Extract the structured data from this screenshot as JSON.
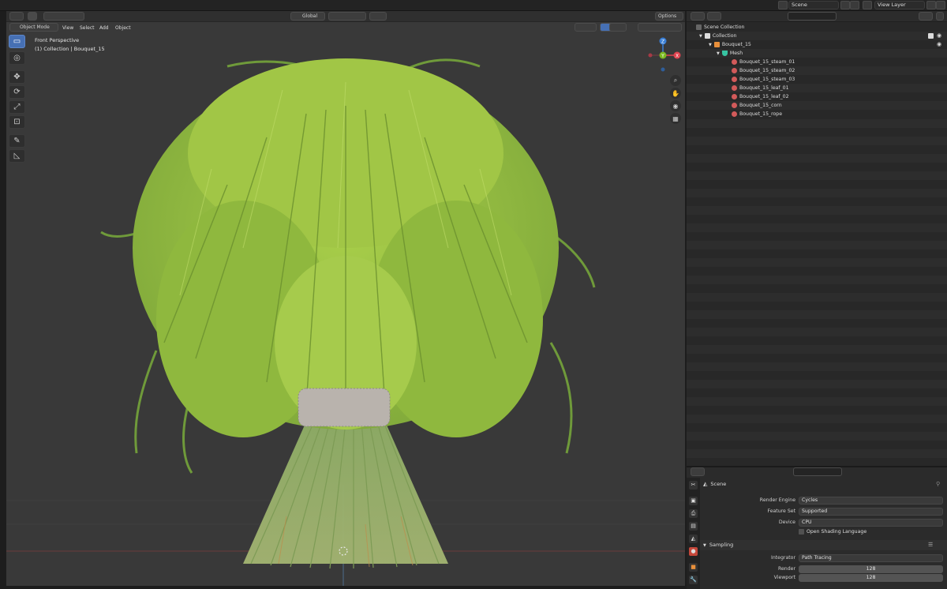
{
  "topbar": {
    "scene": "Scene",
    "view_layer": "View Layer"
  },
  "viewport": {
    "mode": "Object Mode",
    "menus": [
      "View",
      "Select",
      "Add",
      "Object"
    ],
    "transform_orientation": "Global",
    "options_label": "Options",
    "info_line1": "Front Perspective",
    "info_line2": "(1) Collection | Bouquet_15",
    "gizmo_axes": {
      "x": "X",
      "y": "Y",
      "z": "Z"
    },
    "colors": {
      "x": "#e0434f",
      "y": "#7bb81f",
      "z": "#3a7fd6",
      "bg": "#393939",
      "active_tool": "#4670b4"
    }
  },
  "toolbar": {
    "tools": [
      "select-box",
      "cursor",
      "move",
      "rotate",
      "scale",
      "transform",
      "annotate",
      "measure"
    ]
  },
  "outliner": {
    "root": "Scene Collection",
    "collection": "Collection",
    "object": "Bouquet_15",
    "mesh": "Mesh",
    "materials": [
      "Bouquet_15_steam_01",
      "Bouquet_15_steam_02",
      "Bouquet_15_steam_03",
      "Bouquet_15_leaf_01",
      "Bouquet_15_leaf_02",
      "Bouquet_15_corn",
      "Bouquet_15_rope"
    ]
  },
  "properties": {
    "context": "Scene",
    "render_engine_label": "Render Engine",
    "render_engine": "Cycles",
    "feature_set_label": "Feature Set",
    "feature_set": "Supported",
    "device_label": "Device",
    "device": "CPU",
    "osl_label": "Open Shading Language",
    "sampling_title": "Sampling",
    "integrator_label": "Integrator",
    "integrator": "Path Tracing",
    "render_label": "Render",
    "render_samples": "128",
    "viewport_label": "Viewport",
    "viewport_samples": "128"
  }
}
